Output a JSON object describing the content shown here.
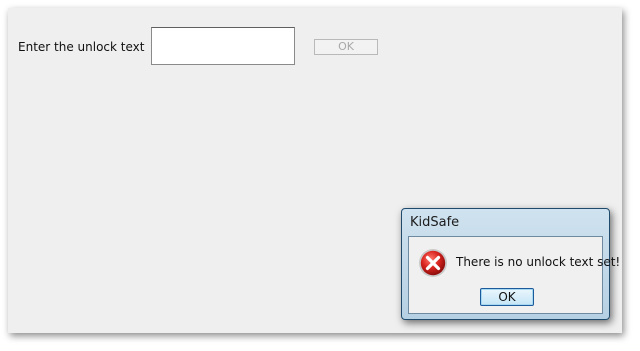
{
  "main_window": {
    "unlock_label": "Enter the unlock text",
    "unlock_input_value": "",
    "ok_button_label": "OK",
    "ok_button_enabled": false
  },
  "dialog": {
    "title": "KidSafe",
    "icon": "error-icon",
    "message": "There is no unlock text set!",
    "ok_button_label": "OK"
  },
  "colors": {
    "window_background": "#efefef",
    "dialog_frame": "#b6d0e3",
    "error_red": "#d9241f"
  }
}
